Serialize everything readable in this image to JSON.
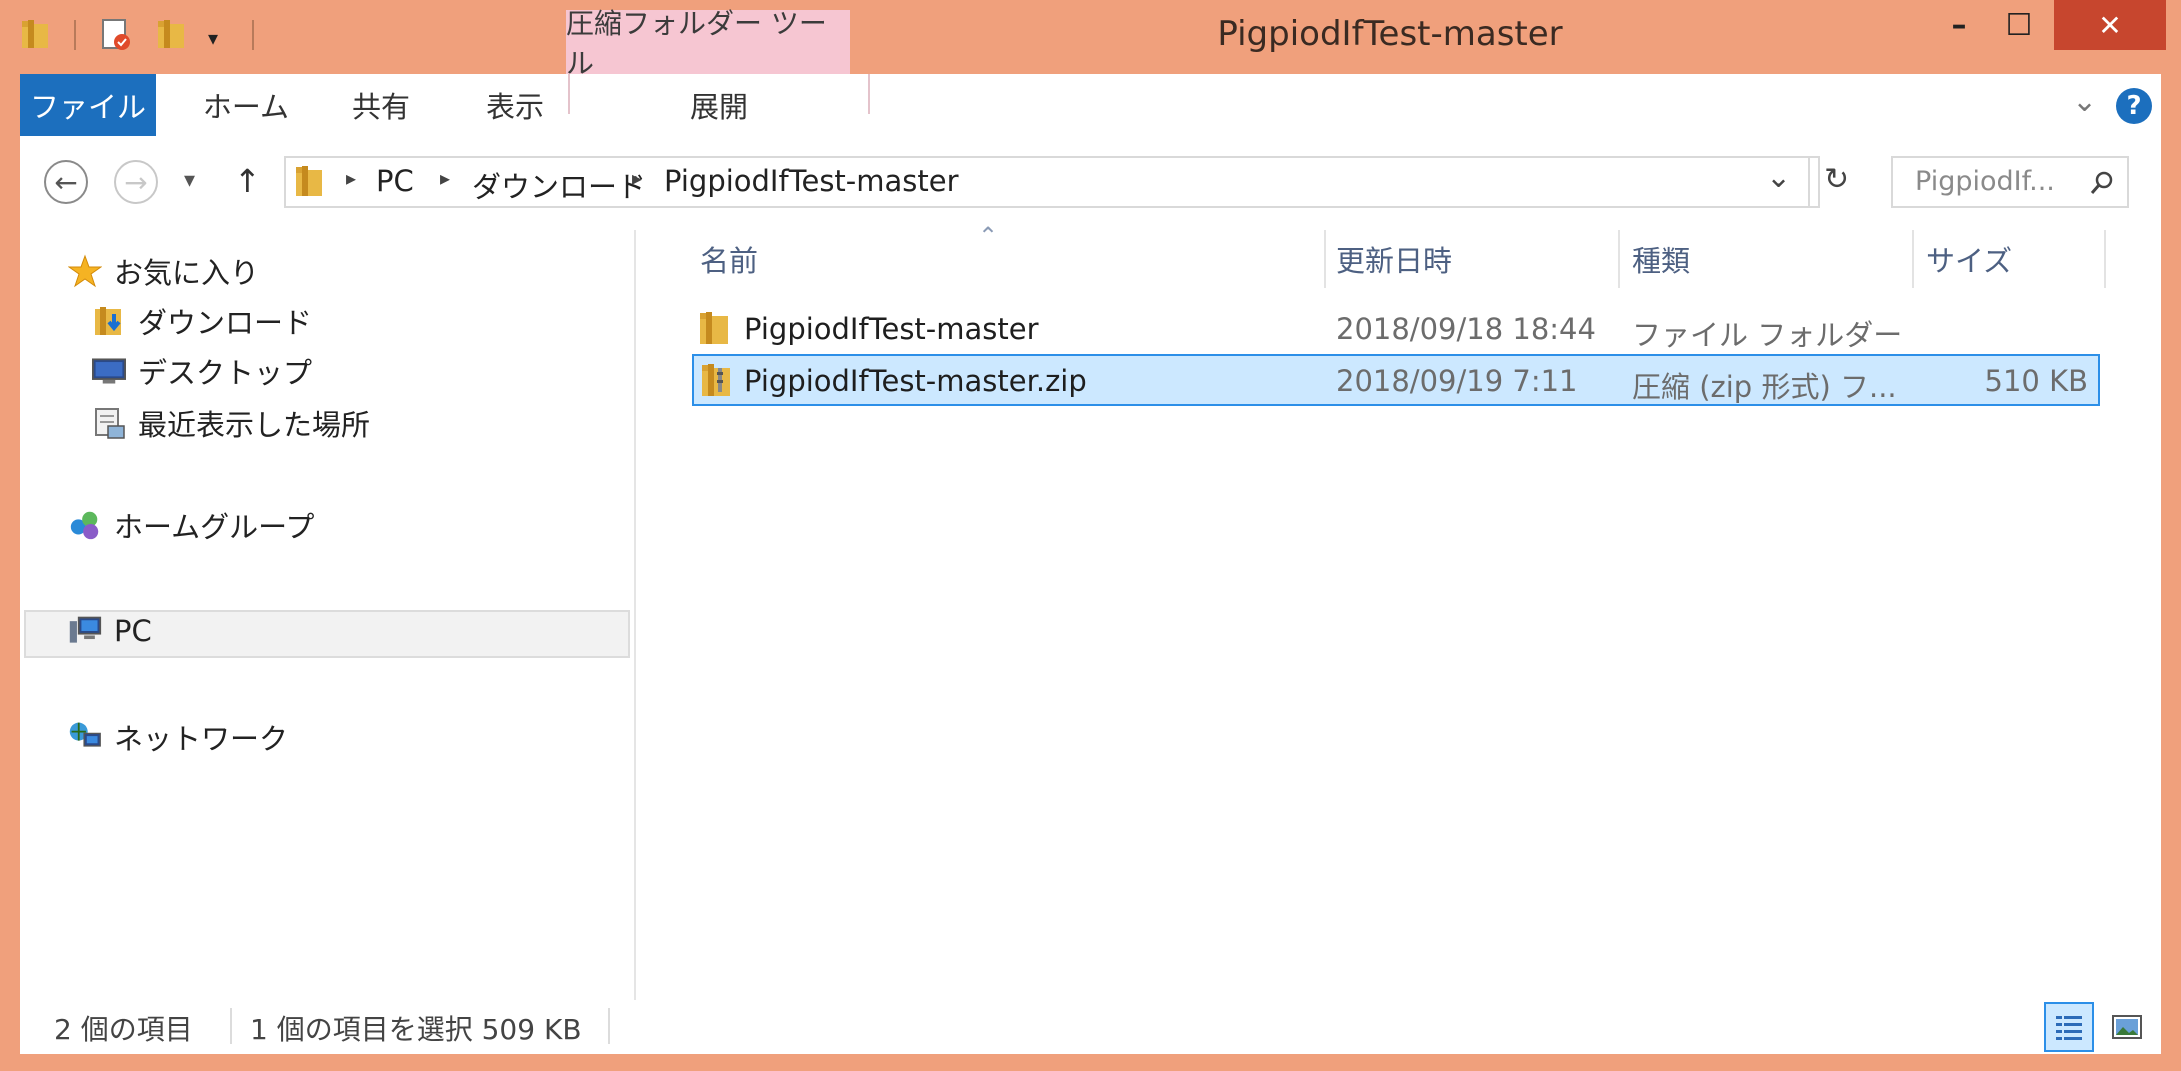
{
  "titlebar": {
    "title": "PigpiodIfTest-master",
    "context_tab": "圧縮フォルダー ツール",
    "minimize": "–",
    "maximize": "☐",
    "close": "✕"
  },
  "ribbon": {
    "tabs": [
      "ファイル",
      "ホーム",
      "共有",
      "表示",
      "展開"
    ],
    "collapse_glyph": "⌄",
    "help_glyph": "?"
  },
  "address": {
    "back": "←",
    "forward": "→",
    "recent": "▾",
    "up": "↑",
    "breadcrumb": [
      "PC",
      "ダウンロード",
      "PigpiodIfTest-master"
    ],
    "separator": "▸",
    "dropdown": "⌄",
    "refresh": "↻",
    "search_placeholder": "PigpiodIf..."
  },
  "nav": {
    "favorites": "お気に入り",
    "downloads": "ダウンロード",
    "desktop": "デスクトップ",
    "recent_places": "最近表示した場所",
    "homegroup": "ホームグループ",
    "pc": "PC",
    "network": "ネットワーク"
  },
  "columns": {
    "name": "名前",
    "modified": "更新日時",
    "type": "種類",
    "size": "サイズ",
    "sort_arrow": "⌃"
  },
  "files": [
    {
      "name": "PigpiodIfTest-master",
      "modified": "2018/09/18 18:44",
      "type": "ファイル フォルダー",
      "size": "",
      "icon": "folder-icon"
    },
    {
      "name": "PigpiodIfTest-master.zip",
      "modified": "2018/09/19 7:11",
      "type": "圧縮 (zip 形式) フ...",
      "size": "510 KB",
      "icon": "zip-folder-icon"
    }
  ],
  "status": {
    "count": "2 個の項目",
    "selection": "1 個の項目を選択  509 KB"
  },
  "colors": {
    "frame": "#f0a07c",
    "file_tab": "#1c6fbe",
    "context_tab": "#f6c6d2",
    "selection_fill": "#cce8ff",
    "selection_border": "#2c8fe8",
    "close_button": "#c7462e"
  }
}
